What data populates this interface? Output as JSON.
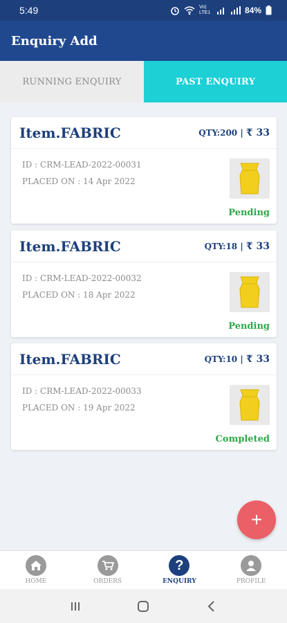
{
  "status_bar": {
    "time": "5:49",
    "network": "Vo) LTE1",
    "battery": "84%"
  },
  "app_bar": {
    "title": "Enquiry Add"
  },
  "tabs": [
    {
      "label": "RUNNING ENQUIRY",
      "active": false
    },
    {
      "label": "PAST ENQUIRY",
      "active": true
    }
  ],
  "enquiries": [
    {
      "title": "Item.FABRIC",
      "qty": "QTY:200 |",
      "price": "₹ 33",
      "id": "ID : CRM-LEAD-2022-00031",
      "placed": "PLACED ON : 14 Apr 2022",
      "status": "Pending"
    },
    {
      "title": "Item.FABRIC",
      "qty": "QTY:18 |",
      "price": "₹ 33",
      "id": "ID : CRM-LEAD-2022-00032",
      "placed": "PLACED ON : 18 Apr 2022",
      "status": "Pending"
    },
    {
      "title": "Item.FABRIC",
      "qty": "QTY:10 |",
      "price": "₹ 33",
      "id": "ID : CRM-LEAD-2022-00033",
      "placed": "PLACED ON : 19 Apr 2022",
      "status": "Completed"
    }
  ],
  "fab": {
    "label": "+"
  },
  "bottom_nav": [
    {
      "label": "HOME",
      "icon": "home-icon",
      "active": false
    },
    {
      "label": "ORDERS",
      "icon": "cart-icon",
      "active": false
    },
    {
      "label": "ENQUIRY",
      "icon": "question-icon",
      "active": true
    },
    {
      "label": "PROFILE",
      "icon": "person-icon",
      "active": false
    }
  ],
  "colors": {
    "primary": "#20488f",
    "accent_tab": "#1cd0d6",
    "status_green": "#2fa84a",
    "fab": "#eb5f66"
  }
}
